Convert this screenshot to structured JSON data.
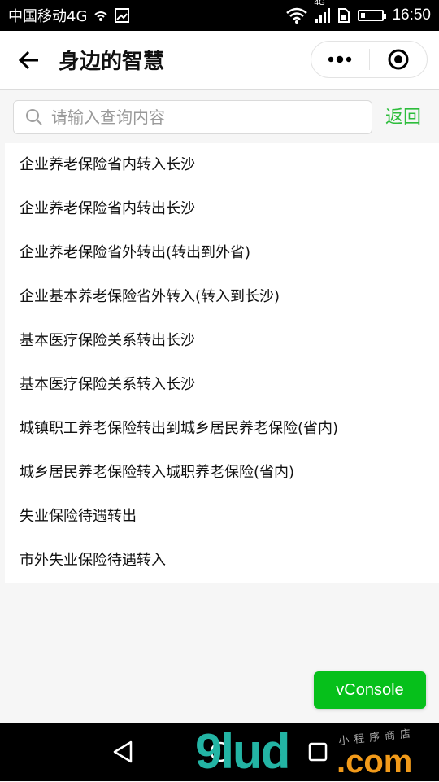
{
  "status_bar": {
    "carrier": "中国移动4G",
    "network_badge": "4G",
    "time": "16:50",
    "battery_level_percent": 20,
    "icons": [
      "wifi-small-icon",
      "image-icon",
      "wifi-icon",
      "signal-icon",
      "sim-icon",
      "battery-icon"
    ]
  },
  "header": {
    "title": "身边的智慧",
    "back_icon": "arrow-left-icon",
    "more_icon": "more-dots-icon",
    "close_icon": "target-circle-icon"
  },
  "search": {
    "placeholder": "请输入查询内容",
    "value": "",
    "return_label": "返回"
  },
  "list": {
    "items": [
      "企业养老保险省内转入长沙",
      "企业养老保险省内转出长沙",
      "企业养老保险省外转出(转出到外省)",
      "企业基本养老保险省外转入(转入到长沙)",
      "基本医疗保险关系转出长沙",
      "基本医疗保险关系转入长沙",
      "城镇职工养老保险转出到城乡居民养老保险(省内)",
      "城乡居民养老保险转入城职养老保险(省内)",
      "失业保险待遇转出",
      "市外失业保险待遇转入"
    ]
  },
  "vconsole": {
    "label": "vConsole"
  },
  "watermark": {
    "brand": "9lud",
    "domain": ".com",
    "chinese": "小程序商店"
  },
  "colors": {
    "accent_green": "#2dbd3c",
    "vconsole_green": "#06c01b"
  }
}
